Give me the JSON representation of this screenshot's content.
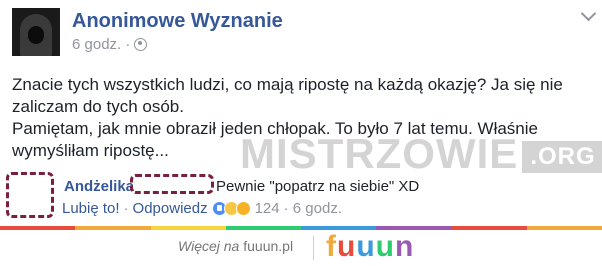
{
  "post": {
    "page_name": "Anonimowe Wyznanie",
    "time": "6 godz. ·",
    "lines": [
      "Znacie tych wszystkich ludzi, co mają ripostę na każdą okazję? Ja się nie",
      "zaliczam do tych osób.",
      "Pamiętam, jak mnie obraził jeden chłopak. To było 7 lat temu. Właśnie",
      "wymyśliłam ripostę..."
    ]
  },
  "watermark": {
    "text": "MISTRZOWIE",
    "suffix": ".ORG"
  },
  "comment": {
    "author": "Andżelika",
    "text": "Pewnie \"popatrz na siebie\" XD",
    "like_label": "Lubię to!",
    "separator": "·",
    "reply_label": "Odpowiedz",
    "reactions_count": "124",
    "time": "· 6 godz."
  },
  "footer": {
    "more_prefix": "Więcej na ",
    "more_site": "fuuun.pl",
    "logo": [
      "f",
      "u",
      "u",
      "u",
      "n"
    ]
  },
  "colors": {
    "link_blue": "#365899",
    "meta_gray": "#90949c",
    "redaction": "#7a1f3d",
    "strip": [
      "#e84c3d",
      "#f2a93b",
      "#f7d33c",
      "#2ecc71",
      "#3b9ad9",
      "#9b59b6",
      "#e84c3d",
      "#f2a93b"
    ]
  }
}
